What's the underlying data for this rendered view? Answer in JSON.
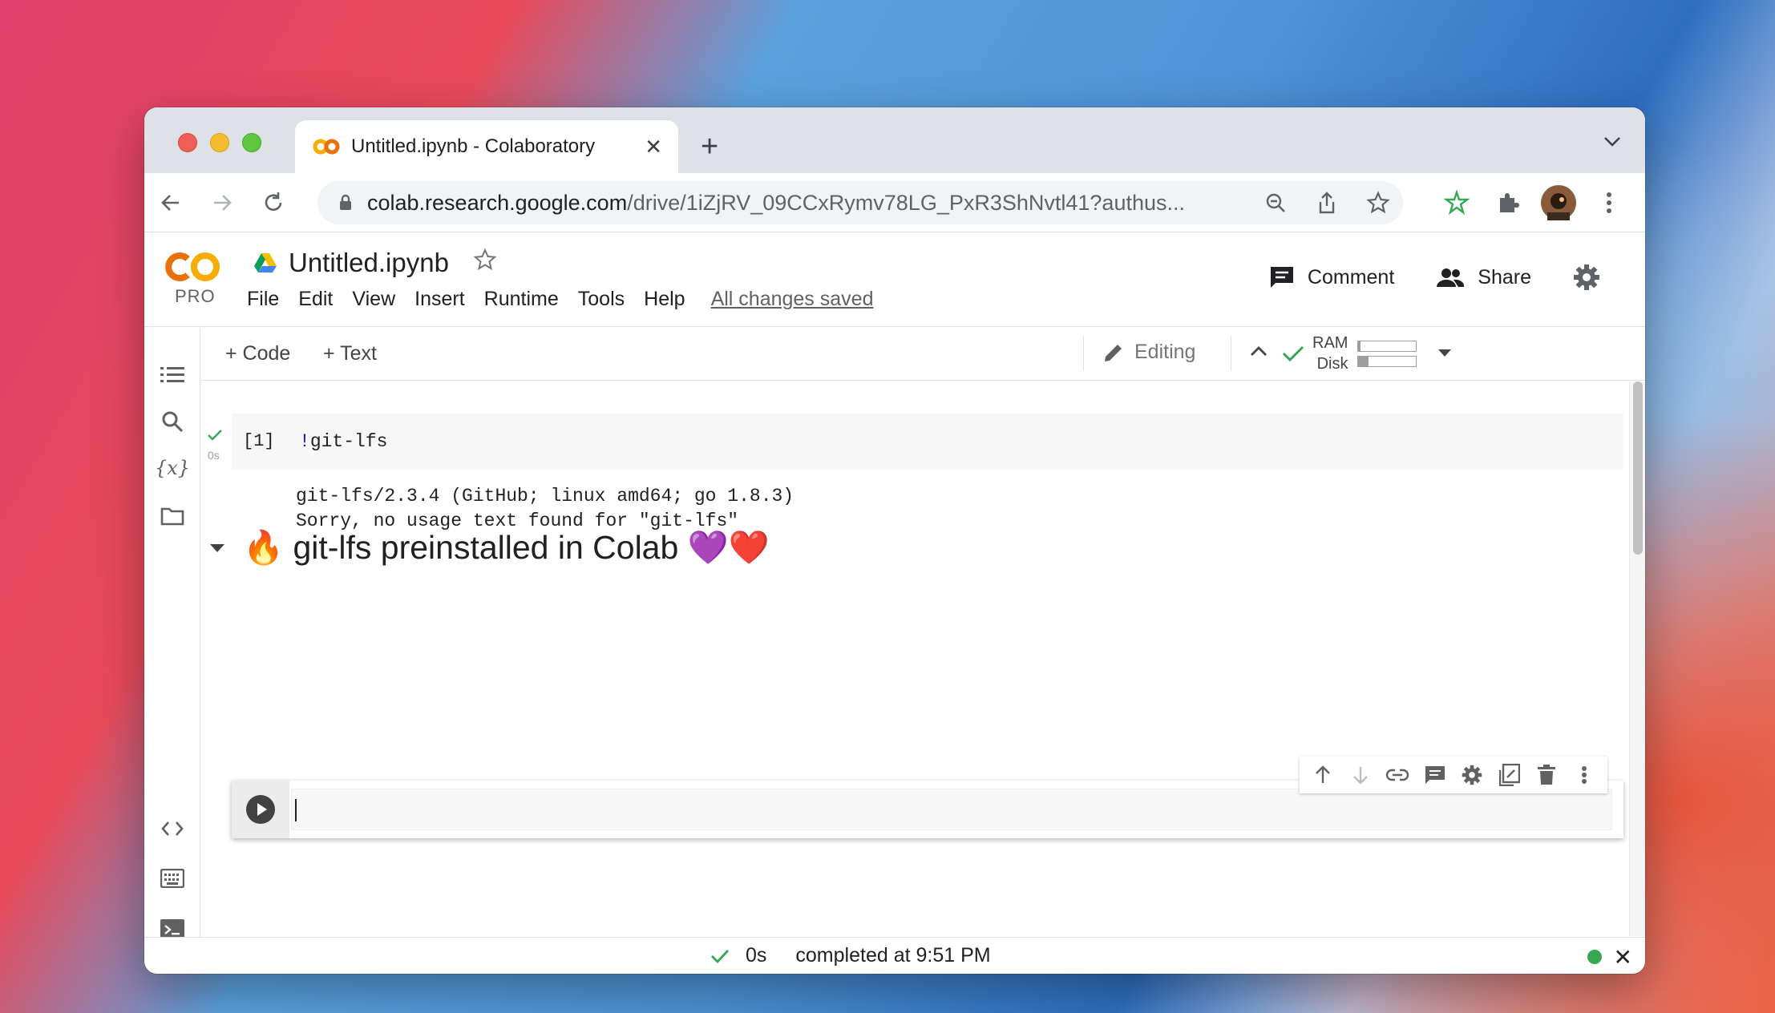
{
  "browser": {
    "tab_title": "Untitled.ipynb - Colaboratory",
    "url_host": "colab.research.google.com",
    "url_path": "/drive/1iZjRV_09CCxRymv78LG_PxR3ShNvtl41?authus..."
  },
  "colab": {
    "logo_badge": "PRO",
    "doc_title": "Untitled.ipynb",
    "menu": [
      "File",
      "Edit",
      "View",
      "Insert",
      "Runtime",
      "Tools",
      "Help"
    ],
    "save_status": "All changes saved",
    "comment_label": "Comment",
    "share_label": "Share"
  },
  "notebook_toolbar": {
    "add_code_label": "+ Code",
    "add_text_label": "+ Text",
    "ram_label": "RAM",
    "disk_label": "Disk",
    "ram_usage_fraction": 0.04,
    "disk_usage_fraction": 0.18,
    "editing_label": "Editing"
  },
  "cells": {
    "code_cell": {
      "exec_count": "[1]",
      "code_bang": "!",
      "code_rest": "git-lfs",
      "exec_time": "0s",
      "output_lines": [
        "git-lfs/2.3.4 (GitHub; linux amd64; go 1.8.3)",
        "Sorry, no usage text found for \"git-lfs\""
      ]
    },
    "heading": "🔥 git-lfs preinstalled in Colab 💜❤️"
  },
  "status_bar": {
    "duration": "0s",
    "completed_text": "completed at 9:51 PM"
  },
  "colors": {
    "accent_orange": "#f9ab00",
    "check_green": "#34a853",
    "runtime_dot": "#34a853"
  }
}
